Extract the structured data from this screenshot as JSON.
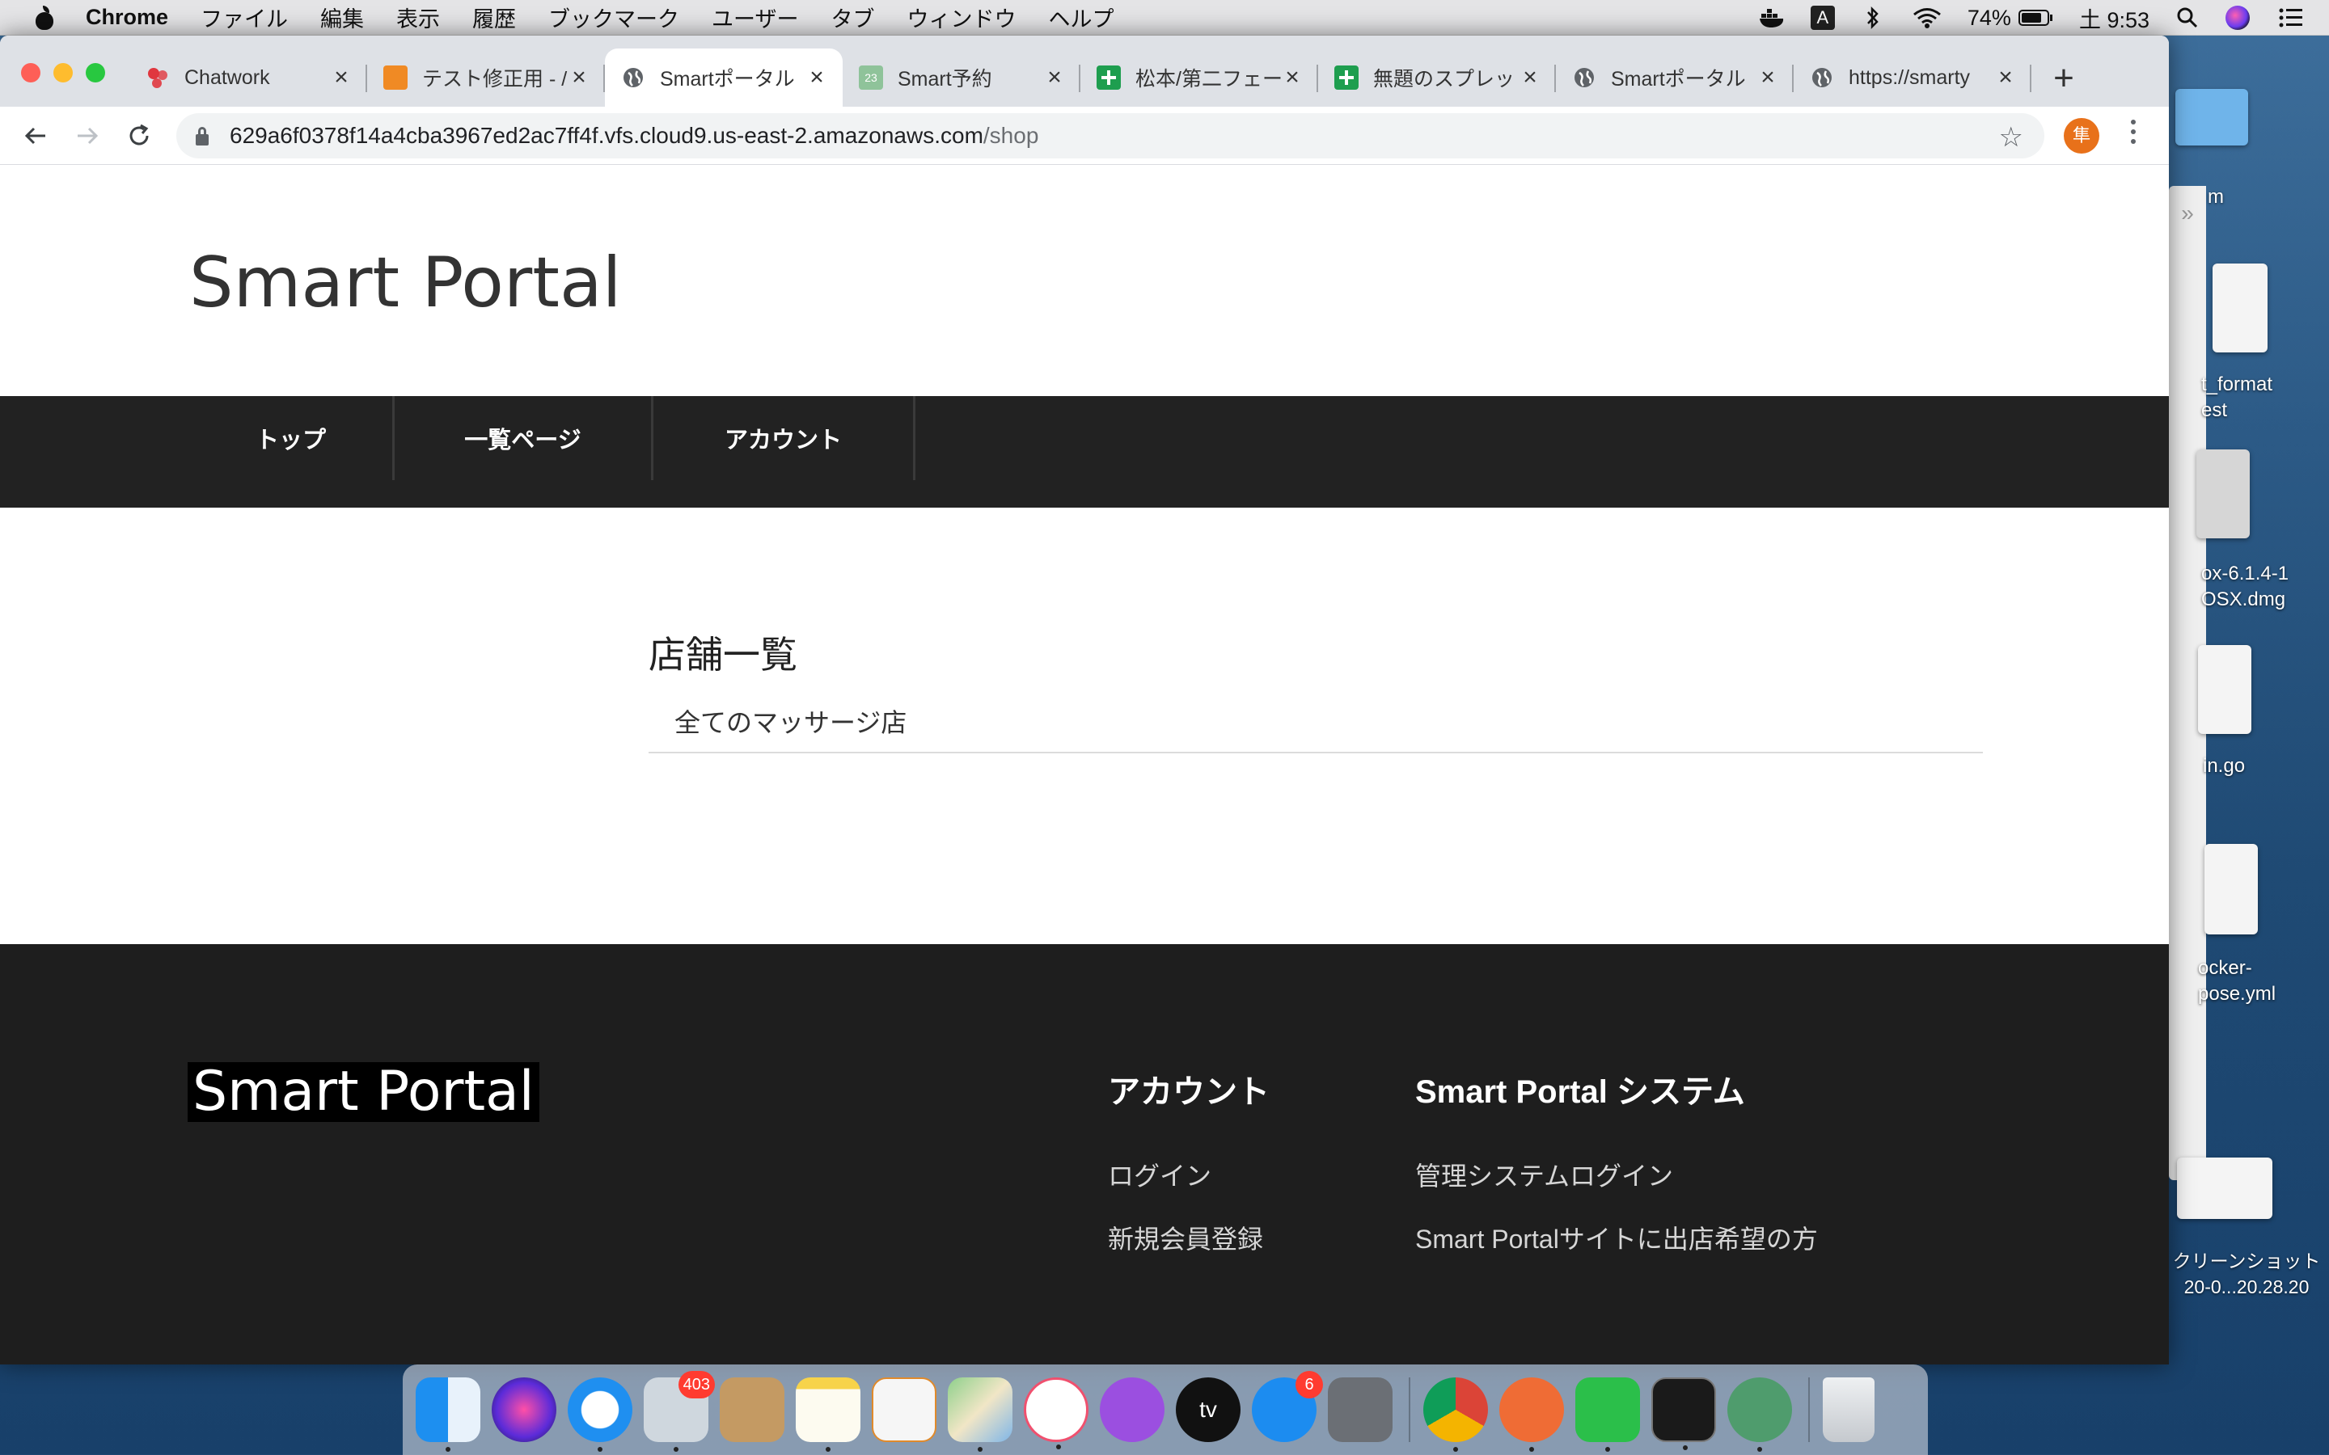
{
  "menubar": {
    "app_name": "Chrome",
    "items": [
      "ファイル",
      "編集",
      "表示",
      "履歴",
      "ブックマーク",
      "ユーザー",
      "タブ",
      "ウィンドウ",
      "ヘルプ"
    ],
    "keyboard_indicator": "A",
    "battery": "74%",
    "clock": "土 9:53"
  },
  "browser": {
    "tabs": [
      {
        "title": "Chatwork",
        "icon": "chatwork-icon",
        "color": "#e0373f"
      },
      {
        "title": "テスト修正用 - /",
        "icon": "box-icon",
        "color": "#f08a24"
      },
      {
        "title": "Smartポータル",
        "icon": "globe-icon",
        "color": "#5f6368",
        "active": true
      },
      {
        "title": "Smart予約",
        "icon": "calendar-icon",
        "color": "#8fc39a"
      },
      {
        "title": "松本/第二フェー",
        "icon": "sheets-icon",
        "color": "#1e9e4f"
      },
      {
        "title": "無題のスプレッ",
        "icon": "sheets-icon",
        "color": "#1e9e4f"
      },
      {
        "title": "Smartポータル",
        "icon": "globe-icon",
        "color": "#5f6368"
      },
      {
        "title": "https://smarty",
        "icon": "globe-icon",
        "color": "#5f6368"
      }
    ],
    "url_host": "629a6f0378f14a4cba3967ed2ac7ff4f.vfs.cloud9.us-east-2.amazonaws.com",
    "url_path": "/shop",
    "profile_initial": "隼"
  },
  "site": {
    "title": "Smart Portal",
    "nav": [
      "トップ",
      "一覧ページ",
      "アカウント"
    ],
    "section_heading": "店舗一覧",
    "list_items": [
      "全てのマッサージ店"
    ],
    "footer": {
      "logo": "Smart Portal",
      "col1_heading": "アカウント",
      "col1_links": [
        "ログイン",
        "新規会員登録"
      ],
      "col2_heading": "Smart Portal システム",
      "col2_links": [
        "管理システムログイン",
        "Smart Portalサイトに出店希望の方"
      ]
    }
  },
  "desktop": {
    "files": [
      "m",
      "t_format\nest",
      "ox-6.1.4-1\nOSX.dmg",
      "in.go",
      "ocker-\npose.yml",
      "クリーンショット\n20-0...20.28.20"
    ]
  },
  "dock": {
    "mail_badge": "403",
    "appstore_badge": "6",
    "tv_label": "tv"
  }
}
